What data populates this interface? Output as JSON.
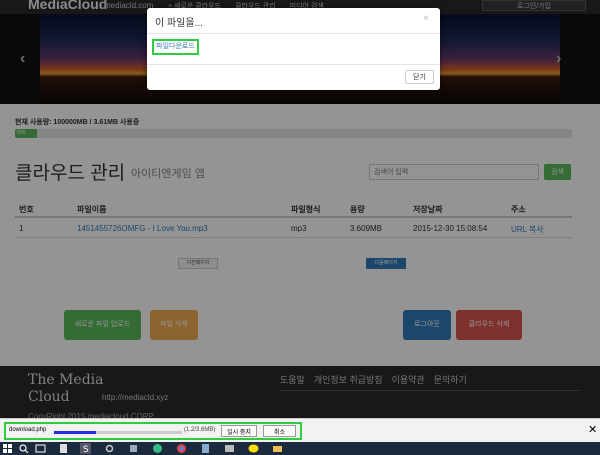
{
  "navbar": {
    "brand": "MediaCloud",
    "brand_sub": "mediacld.com",
    "items": [
      "+ 새로운 클라우드",
      "클라우드 관리",
      "미디어 검색"
    ],
    "login": "로그인/가입"
  },
  "carousel": {
    "prev": "‹",
    "next": "›"
  },
  "usage": "현재 사용량: 100000MB / 3.61MB 사용중",
  "progress": {
    "label": "0%",
    "fraction": 0.04
  },
  "page": {
    "title": "클라우드 관리",
    "subtitle": "아이티엔게임 앱"
  },
  "search": {
    "placeholder": "검색어 입력",
    "button": "검색"
  },
  "table": {
    "headers": [
      "번호",
      "파일이름",
      "파일형식",
      "용량",
      "저장날짜",
      "주소"
    ],
    "rows": [
      [
        "1",
        "1451455726OMFG - I Love You.mp3",
        "mp3",
        "3.609MB",
        "2015-12-30 15:08:54",
        "URL 복사"
      ]
    ]
  },
  "pager": {
    "prev": "이전페이지",
    "next": "다음페이지"
  },
  "buttons": {
    "upload": "새로운 파일 업로드",
    "delete": "파일 삭제",
    "logout": "로그아웃",
    "cloud_delete": "클라우드 삭제"
  },
  "footer": {
    "title_line1": "The Media",
    "title_line2": "Cloud",
    "url": "http://mediacld.xyz",
    "links": [
      "도움말",
      "개인정보 취급방침",
      "이용약관",
      "문의하기"
    ],
    "copyright": "CopyRight 2015 mediacloud CORP"
  },
  "modal": {
    "title": "이 파일을...",
    "close": "×",
    "download_link": "파일다운로드",
    "close_button": "닫기"
  },
  "download": {
    "filename": "download.php",
    "size": "(1.2/3.6MB)",
    "progress": 0.33,
    "pause": "일시 중지",
    "cancel": "취소",
    "close": "✕"
  },
  "colors": {
    "success": "#5cb85c",
    "warning": "#f0ad4e",
    "primary": "#337ab7",
    "danger": "#d9534f",
    "highlight": "#2ecc40"
  }
}
